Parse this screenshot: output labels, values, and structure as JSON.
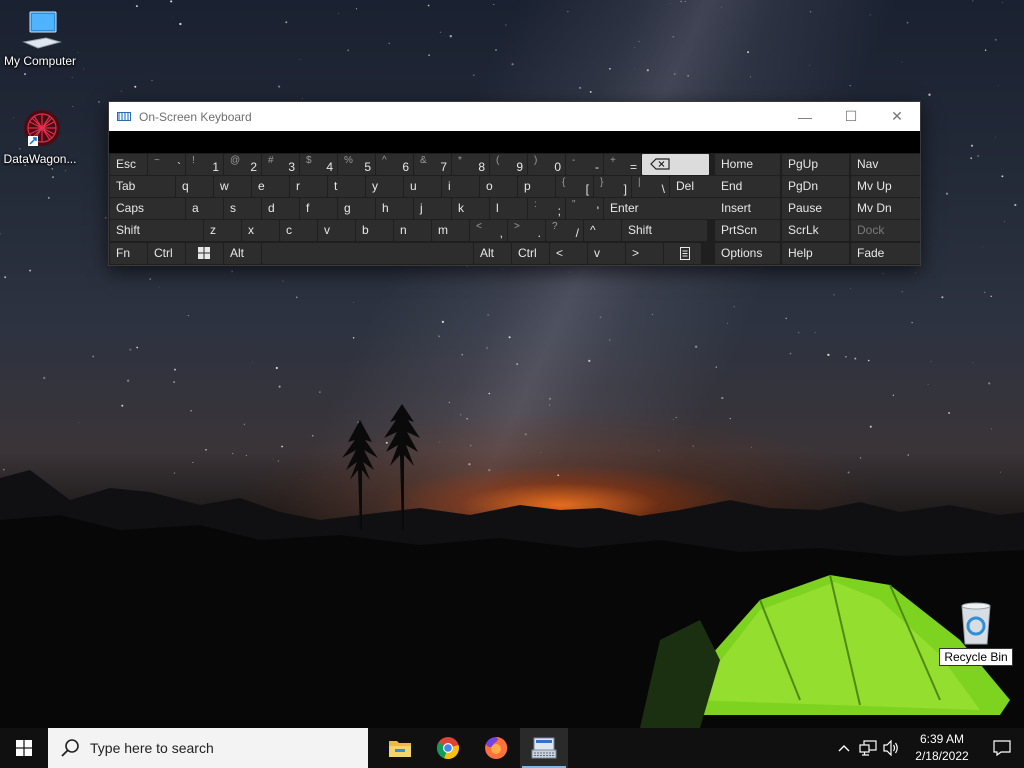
{
  "desktop": {
    "icons": [
      {
        "label": "My Computer",
        "icon": "computer-icon"
      },
      {
        "label": "DataWagon...",
        "icon": "datawagon-shortcut-icon"
      },
      {
        "label": "Recycle Bin",
        "icon": "recycle-bin-icon"
      }
    ]
  },
  "osk": {
    "title": "On-Screen Keyboard",
    "window_buttons": {
      "minimize": "—",
      "maximize": "☐",
      "close": "✕"
    },
    "rows": [
      [
        {
          "label": "Esc"
        },
        {
          "shift": "~",
          "main": "`"
        },
        {
          "shift": "!",
          "main": "1"
        },
        {
          "shift": "@",
          "main": "2"
        },
        {
          "shift": "#",
          "main": "3"
        },
        {
          "shift": "$",
          "main": "4"
        },
        {
          "shift": "%",
          "main": "5"
        },
        {
          "shift": "^",
          "main": "6"
        },
        {
          "shift": "&",
          "main": "7"
        },
        {
          "shift": "*",
          "main": "8"
        },
        {
          "shift": "(",
          "main": "9"
        },
        {
          "shift": ")",
          "main": "0"
        },
        {
          "shift": "-",
          "main": "-"
        },
        {
          "shift": "+",
          "main": "="
        },
        {
          "icon": "backspace-icon"
        }
      ],
      [
        {
          "label": "Tab"
        },
        {
          "label": "q"
        },
        {
          "label": "w"
        },
        {
          "label": "e"
        },
        {
          "label": "r"
        },
        {
          "label": "t"
        },
        {
          "label": "y"
        },
        {
          "label": "u"
        },
        {
          "label": "i"
        },
        {
          "label": "o"
        },
        {
          "label": "p"
        },
        {
          "shift": "{",
          "main": "["
        },
        {
          "shift": "}",
          "main": "]"
        },
        {
          "shift": "|",
          "main": "\\"
        },
        {
          "label": "Del"
        }
      ],
      [
        {
          "label": "Caps"
        },
        {
          "label": "a"
        },
        {
          "label": "s"
        },
        {
          "label": "d"
        },
        {
          "label": "f"
        },
        {
          "label": "g"
        },
        {
          "label": "h"
        },
        {
          "label": "j"
        },
        {
          "label": "k"
        },
        {
          "label": "l"
        },
        {
          "shift": ":",
          "main": ";"
        },
        {
          "shift": "\"",
          "main": "'"
        },
        {
          "label": "Enter"
        }
      ],
      [
        {
          "label": "Shift"
        },
        {
          "label": "z"
        },
        {
          "label": "x"
        },
        {
          "label": "c"
        },
        {
          "label": "v"
        },
        {
          "label": "b"
        },
        {
          "label": "n"
        },
        {
          "label": "m"
        },
        {
          "shift": "<",
          "main": ","
        },
        {
          "shift": ">",
          "main": "."
        },
        {
          "shift": "?",
          "main": "/"
        },
        {
          "label": "^"
        },
        {
          "label": "Shift"
        }
      ],
      [
        {
          "label": "Fn"
        },
        {
          "label": "Ctrl"
        },
        {
          "icon": "windows-logo-icon"
        },
        {
          "label": "Alt"
        },
        {
          "label": ""
        },
        {
          "label": "Alt"
        },
        {
          "label": "Ctrl"
        },
        {
          "label": "<"
        },
        {
          "label": "v"
        },
        {
          "label": ">"
        },
        {
          "icon": "context-menu-icon"
        }
      ]
    ],
    "nav_rows": [
      [
        "Home",
        "PgUp",
        "Nav"
      ],
      [
        "End",
        "PgDn",
        "Mv Up"
      ],
      [
        "Insert",
        "Pause",
        "Mv Dn"
      ],
      [
        "PrtScn",
        "ScrLk",
        "Dock"
      ],
      [
        "Options",
        "Help",
        "Fade"
      ]
    ],
    "dimmed_keys": [
      "Dock"
    ]
  },
  "taskbar": {
    "search_placeholder": "Type here to search",
    "apps": [
      "file-explorer-icon",
      "chrome-icon",
      "firefox-icon",
      "on-screen-keyboard-icon"
    ],
    "active_app": "on-screen-keyboard-icon",
    "clock": {
      "time": "6:39 AM",
      "date": "2/18/2022"
    },
    "tray_glyphs": {
      "chevron": "^",
      "volume": "🔊"
    },
    "accent_color": "#76b9ed"
  }
}
